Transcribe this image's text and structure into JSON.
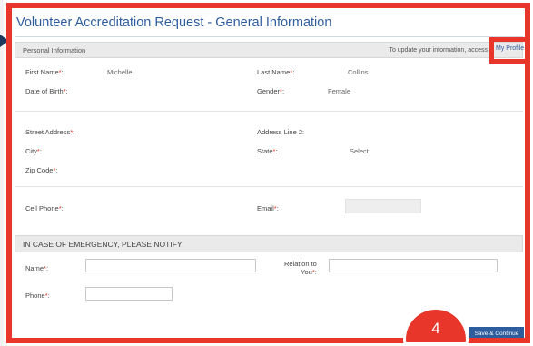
{
  "header": {
    "title": "Volunteer Accreditation Request - General Information"
  },
  "personal_section": {
    "label": "Personal Information",
    "update_note": "To update your information, access",
    "profile_link": "My Profile"
  },
  "fields": {
    "first_name": {
      "label": "First Name",
      "value": "Michelle"
    },
    "last_name": {
      "label": "Last Name",
      "value": "Collins"
    },
    "dob": {
      "label": "Date of Birth"
    },
    "gender": {
      "label": "Gender",
      "value": "Female"
    },
    "street": {
      "label": "Street Address"
    },
    "address2": {
      "label": "Address Line 2:"
    },
    "city": {
      "label": "City"
    },
    "state": {
      "label": "State",
      "value": "Select"
    },
    "zip": {
      "label": "Zip Code"
    },
    "cell": {
      "label": "Cell Phone"
    },
    "email": {
      "label": "Email"
    }
  },
  "emergency_section": {
    "label": "IN CASE OF EMERGENCY, PLEASE NOTIFY",
    "name_label": "Name",
    "relation_label_1": "Relation to",
    "relation_label_2": "You",
    "phone_label": "Phone"
  },
  "actions": {
    "save_label": "Save & Continue"
  },
  "annotation": {
    "step": "4"
  },
  "colors": {
    "highlight": "#e8362b",
    "link": "#2e5d9e",
    "button": "#2e5d9e"
  }
}
